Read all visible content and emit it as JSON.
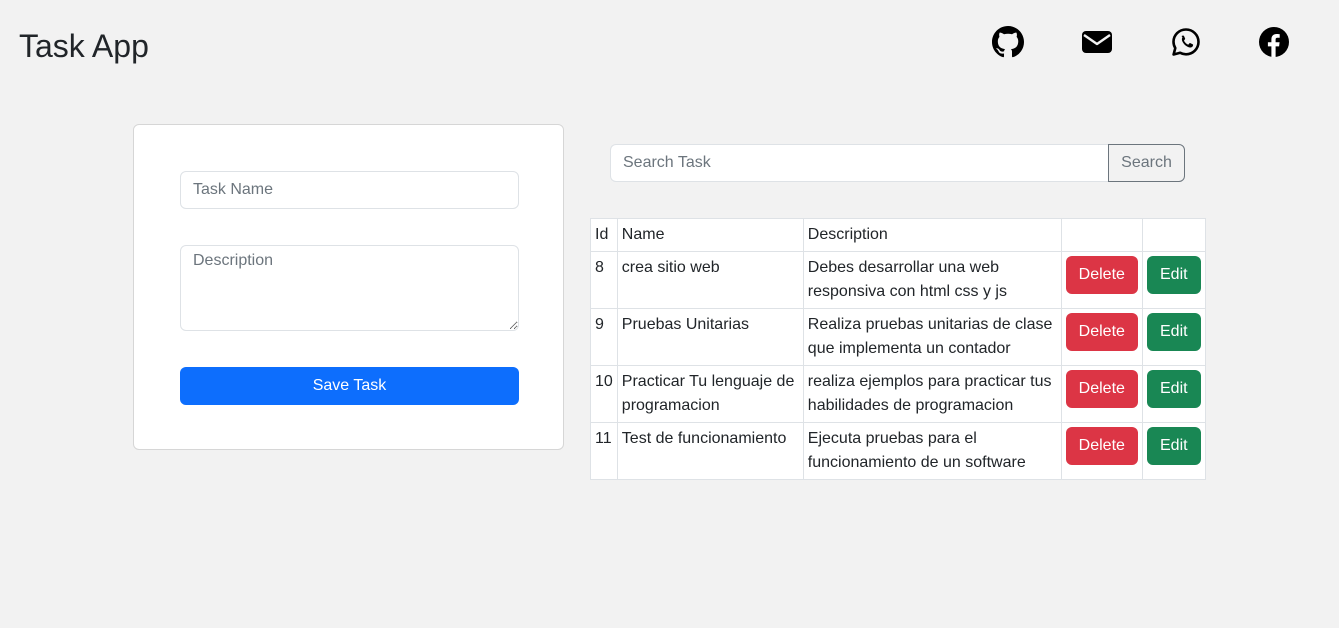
{
  "header": {
    "title": "Task App",
    "social": [
      "github-icon",
      "mail-icon",
      "whatsapp-icon",
      "facebook-icon"
    ]
  },
  "form": {
    "task_name_placeholder": "Task Name",
    "task_name_value": "",
    "description_placeholder": "Description",
    "description_value": "",
    "save_label": "Save Task"
  },
  "search": {
    "placeholder": "Search Task",
    "value": "",
    "button_label": "Search"
  },
  "table": {
    "headers": [
      "Id",
      "Name",
      "Description",
      "",
      ""
    ],
    "rows": [
      {
        "id": "8",
        "name": "crea sitio web",
        "description": "Debes desarrollar una web responsiva con html css y js",
        "delete_label": "Delete",
        "edit_label": "Edit"
      },
      {
        "id": "9",
        "name": "Pruebas Unitarias",
        "description": "Realiza pruebas unitarias de clase que implementa un contador",
        "delete_label": "Delete",
        "edit_label": "Edit"
      },
      {
        "id": "10",
        "name": "Practicar Tu lenguaje de programacion",
        "description": "realiza ejemplos para practicar tus habilidades de programacion",
        "delete_label": "Delete",
        "edit_label": "Edit"
      },
      {
        "id": "11",
        "name": "Test de funcionamiento",
        "description": "Ejecuta pruebas para el funcionamiento de un software",
        "delete_label": "Delete",
        "edit_label": "Edit"
      }
    ]
  },
  "colors": {
    "primary": "#0d6efd",
    "danger": "#dc3545",
    "success": "#198754",
    "secondary": "#6c757d",
    "background": "#f2f2f2"
  }
}
